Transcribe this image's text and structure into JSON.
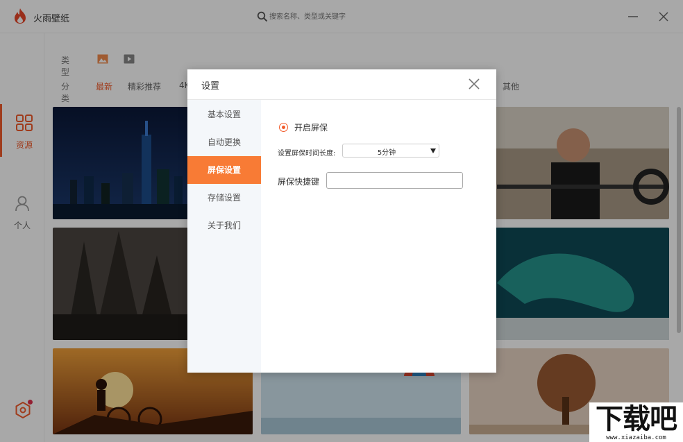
{
  "app": {
    "title": "火雨壁纸",
    "search_placeholder": "搜索名称、类型或关键字"
  },
  "sidebar": {
    "items": [
      {
        "label": "资源",
        "icon": "grid-icon",
        "active": true
      },
      {
        "label": "个人",
        "icon": "user-icon",
        "active": false
      }
    ],
    "settings_icon": "gear-icon"
  },
  "filters": {
    "type_label": "类型",
    "type_icons": [
      "image-icon",
      "video-icon"
    ],
    "category_label": "分类",
    "categories": [
      "最新",
      "精彩推荐",
      "4K",
      "其他"
    ],
    "active_category": "最新"
  },
  "dialog": {
    "title": "设置",
    "nav": [
      "基本设置",
      "自动更换",
      "屏保设置",
      "存储设置",
      "关于我们"
    ],
    "active_nav": "屏保设置",
    "screensaver": {
      "enable_label": "开启屏保",
      "enabled": true,
      "duration_label": "设置屏保时间长度:",
      "duration_value": "5分钟",
      "hotkey_label": "屏保快捷键",
      "hotkey_value": ""
    }
  },
  "watermark": {
    "main": "下载吧",
    "url": "www.xiazaiba.com"
  },
  "colors": {
    "accent": "#f25c2c",
    "nav_active": "#f87b35"
  }
}
